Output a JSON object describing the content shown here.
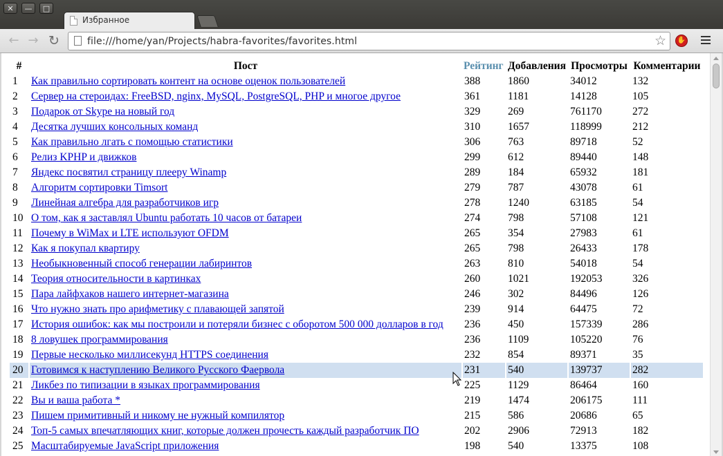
{
  "window": {
    "controls": {
      "close": "✕",
      "minimize": "—",
      "maximize": "□"
    }
  },
  "tab": {
    "title": "Избранное"
  },
  "toolbar": {
    "url": "file:///home/yan/Projects/habra-favorites/favorites.html",
    "back_icon": "arrow-left-icon",
    "forward_icon": "arrow-right-icon",
    "reload_icon": "reload-icon",
    "bookmark_icon": "star-icon",
    "extension_icon": "adblock-icon",
    "menu_icon": "hamburger-menu-icon"
  },
  "table": {
    "headers": {
      "num": "#",
      "post": "Пост",
      "rating": "Рейтинг",
      "adds": "Добавления",
      "views": "Просмотры",
      "comments": "Комментарии"
    },
    "sorted_column_color": "#5a8fae",
    "highlight_color": "#d0dff0",
    "highlighted_row": 20,
    "rows": [
      {
        "n": "1",
        "title": "Как правильно сортировать контент на основе оценок пользователей",
        "rating": "388",
        "adds": "1860",
        "views": "34012",
        "comments": "132"
      },
      {
        "n": "2",
        "title": "Сервер на стероидах: FreeBSD, nginx, MySQL, PostgreSQL, PHP и многое другое",
        "rating": "361",
        "adds": "1181",
        "views": "14128",
        "comments": "105"
      },
      {
        "n": "3",
        "title": "Подарок от Skype на новый год",
        "rating": "329",
        "adds": "269",
        "views": "761170",
        "comments": "272"
      },
      {
        "n": "4",
        "title": "Десятка лучших консольных команд",
        "rating": "310",
        "adds": "1657",
        "views": "118999",
        "comments": "212"
      },
      {
        "n": "5",
        "title": "Как правильно лгать с помощью статистики",
        "rating": "306",
        "adds": "763",
        "views": "89718",
        "comments": "52"
      },
      {
        "n": "6",
        "title": "Релиз KPHP и движков",
        "rating": "299",
        "adds": "612",
        "views": "89440",
        "comments": "148"
      },
      {
        "n": "7",
        "title": "Яндекс посвятил страницу плееру Winamp",
        "rating": "289",
        "adds": "184",
        "views": "65932",
        "comments": "181"
      },
      {
        "n": "8",
        "title": "Алгоритм сортировки Timsort",
        "rating": "279",
        "adds": "787",
        "views": "43078",
        "comments": "61"
      },
      {
        "n": "9",
        "title": "Линейная алгебра для разработчиков игр",
        "rating": "278",
        "adds": "1240",
        "views": "63185",
        "comments": "54"
      },
      {
        "n": "10",
        "title": "О том, как я заставлял Ubuntu работать 10 часов от батареи",
        "rating": "274",
        "adds": "798",
        "views": "57108",
        "comments": "121"
      },
      {
        "n": "11",
        "title": "Почему в WiMax и LTE используют OFDM",
        "rating": "265",
        "adds": "354",
        "views": "27983",
        "comments": "61"
      },
      {
        "n": "12",
        "title": "Как я покупал квартиру",
        "rating": "265",
        "adds": "798",
        "views": "26433",
        "comments": "178"
      },
      {
        "n": "13",
        "title": "Необыкновенный способ генерации лабиринтов",
        "rating": "263",
        "adds": "810",
        "views": "54018",
        "comments": "54"
      },
      {
        "n": "14",
        "title": "Теория относительности в картинках",
        "rating": "260",
        "adds": "1021",
        "views": "192053",
        "comments": "326"
      },
      {
        "n": "15",
        "title": "Пара лайфхаков нашего интернет-магазина",
        "rating": "246",
        "adds": "302",
        "views": "84496",
        "comments": "126"
      },
      {
        "n": "16",
        "title": "Что нужно знать про арифметику с плавающей запятой",
        "rating": "239",
        "adds": "914",
        "views": "64475",
        "comments": "72"
      },
      {
        "n": "17",
        "title": "История ошибок: как мы построили и потеряли бизнес с оборотом 500 000 долларов в год",
        "rating": "236",
        "adds": "450",
        "views": "157339",
        "comments": "286"
      },
      {
        "n": "18",
        "title": "8 ловушек программирования",
        "rating": "236",
        "adds": "1109",
        "views": "105220",
        "comments": "76"
      },
      {
        "n": "19",
        "title": "Первые несколько миллисекунд HTTPS соединения",
        "rating": "232",
        "adds": "854",
        "views": "89371",
        "comments": "35"
      },
      {
        "n": "20",
        "title": "Готовимся к наступлению Великого Русского Фаервола",
        "rating": "231",
        "adds": "540",
        "views": "139737",
        "comments": "282"
      },
      {
        "n": "21",
        "title": "Ликбез по типизации в языках программирования",
        "rating": "225",
        "adds": "1129",
        "views": "86464",
        "comments": "160"
      },
      {
        "n": "22",
        "title": "Вы и ваша работа *",
        "rating": "219",
        "adds": "1474",
        "views": "206175",
        "comments": "111"
      },
      {
        "n": "23",
        "title": "Пишем примитивный и никому не нужный компилятор",
        "rating": "215",
        "adds": "586",
        "views": "20686",
        "comments": "65"
      },
      {
        "n": "24",
        "title": "Топ-5 самых впечатляющих книг, которые должен прочесть каждый разработчик ПО",
        "rating": "202",
        "adds": "2906",
        "views": "72913",
        "comments": "182"
      },
      {
        "n": "25",
        "title": "Масштабируемые JavaScript приложения",
        "rating": "198",
        "adds": "540",
        "views": "13375",
        "comments": "108"
      }
    ]
  }
}
